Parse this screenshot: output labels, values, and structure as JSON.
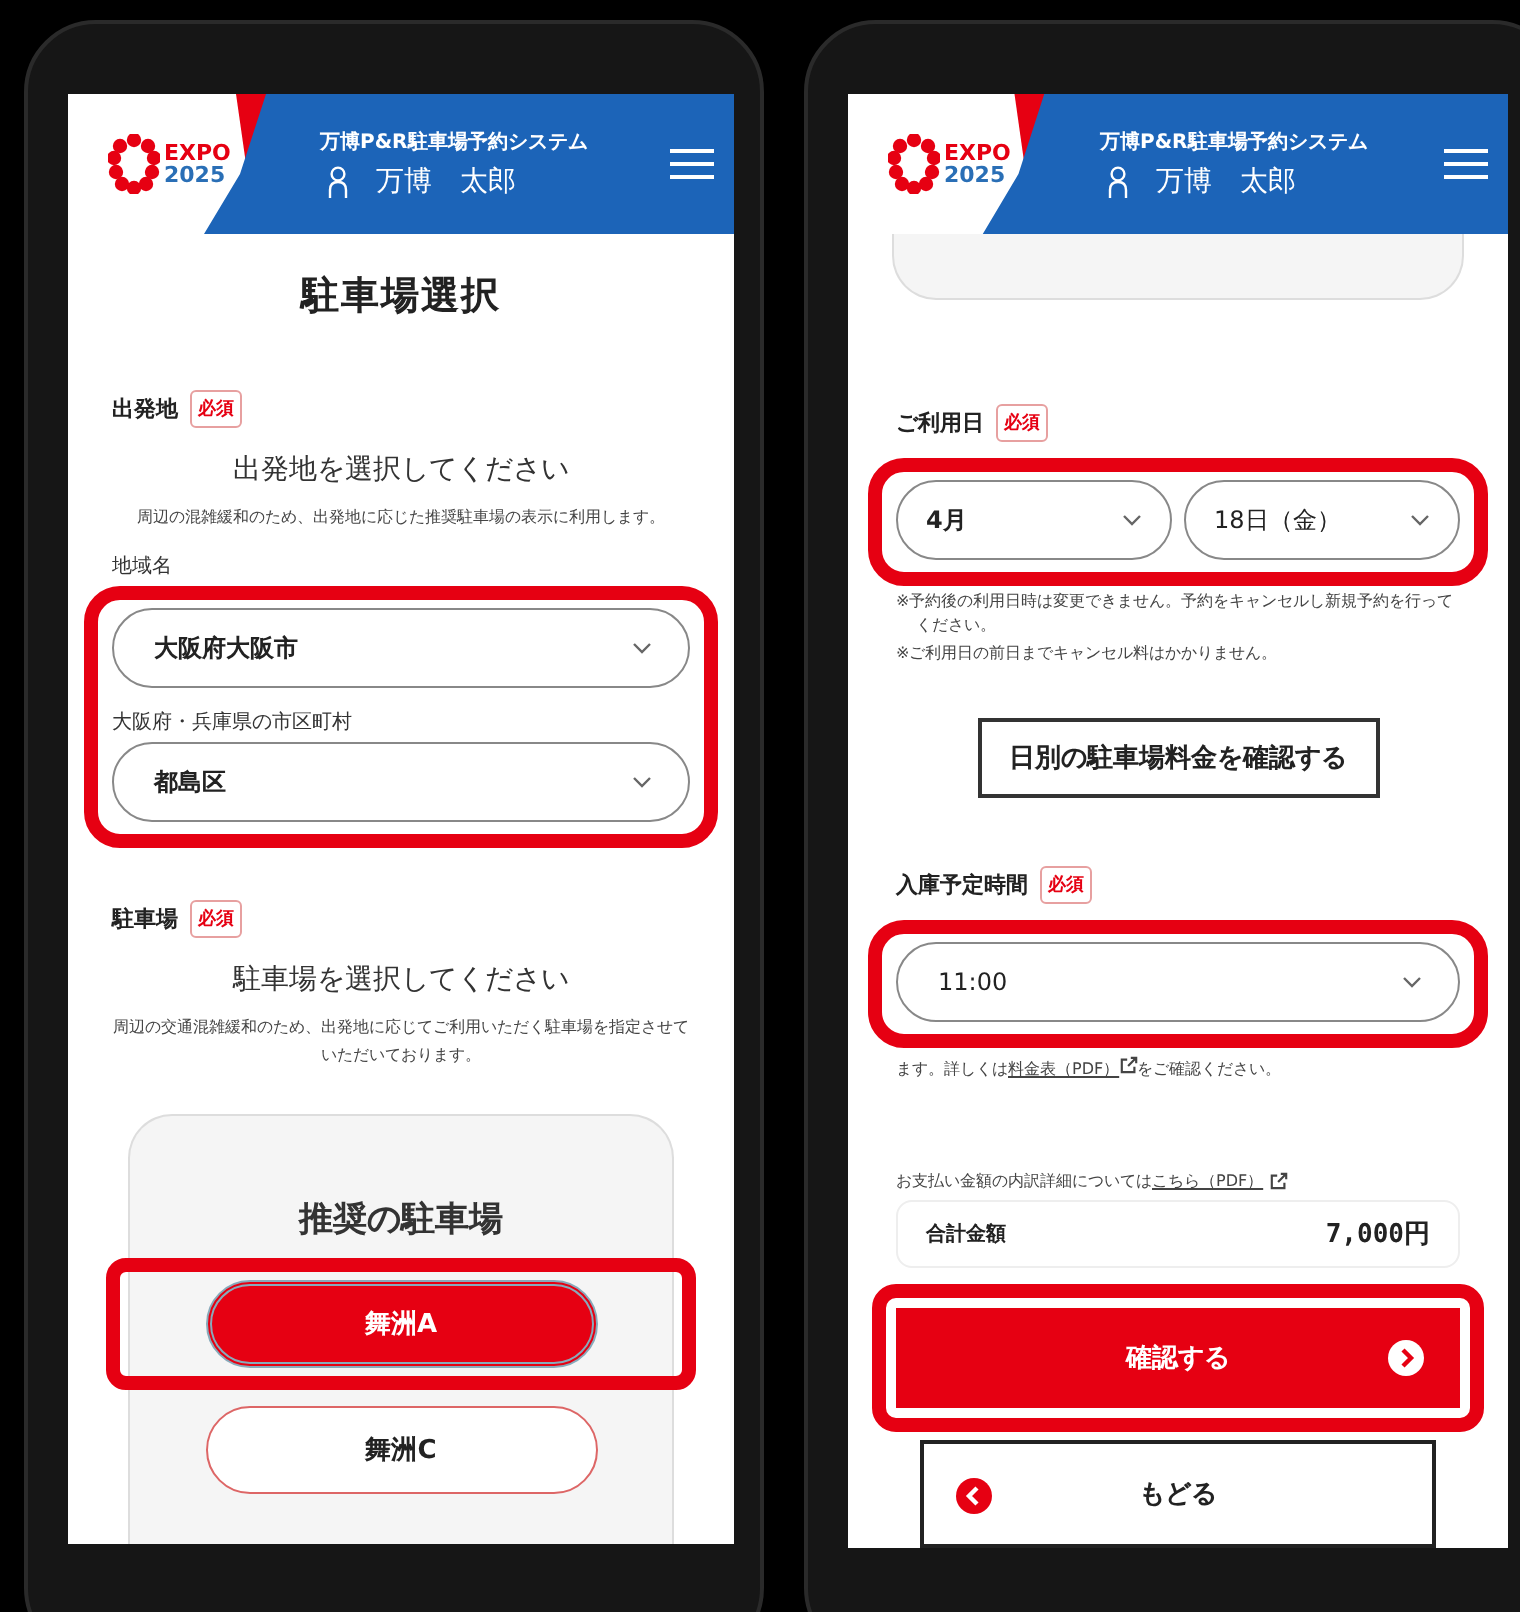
{
  "left_screen": {
    "header": {
      "logo_word": "EXPO",
      "logo_year": "2025",
      "system_title": "万博P&R駐車場予約システム",
      "user_name": "万博　太郎"
    },
    "page_title": "駐車場選択",
    "departure": {
      "label": "出発地",
      "badge": "必須",
      "heading": "出発地を選択してください",
      "note": "周辺の混雑緩和のため、出発地に応じた推奨駐車場の表示に利用します。",
      "highlighted": true,
      "fields": [
        {
          "label": "地域名",
          "value": "大阪府大阪市"
        },
        {
          "label": "大阪府・兵庫県の市区町村",
          "value": "都島区"
        }
      ]
    },
    "parking": {
      "label": "駐車場",
      "badge": "必須",
      "heading": "駐車場を選択してください",
      "note": "周辺の交通混雑緩和のため、出発地に応じてご利用いただく駐車場を指定させていただいております。",
      "card_title": "推奨の駐車場",
      "options": [
        {
          "label": "舞洲A",
          "selected": true,
          "highlighted": true
        },
        {
          "label": "舞洲C",
          "selected": false,
          "highlighted": false
        }
      ]
    }
  },
  "right_screen": {
    "header": {
      "logo_word": "EXPO",
      "logo_year": "2025",
      "system_title": "万博P&R駐車場予約システム",
      "user_name": "万博　太郎"
    },
    "date": {
      "label": "ご利用日",
      "badge": "必須",
      "highlighted": true,
      "selects": [
        "4月",
        "18日（金）"
      ],
      "notes": [
        "※予約後の利用日時は変更できません。予約をキャンセルし新規予約を行ってください。",
        "※ご利用日の前日までキャンセル料はかかりません。"
      ]
    },
    "fee_button": "日別の駐車場料金を確認する",
    "time": {
      "label": "入庫予定時間",
      "badge": "必須",
      "highlighted": true,
      "value": "11:00",
      "note": {
        "before": "ます。詳しくは",
        "link": "料金表（PDF）",
        "after": "をご確認ください。"
      }
    },
    "payment_note": {
      "before": "お支払い金額の内訳詳細については",
      "link": "こちら（PDF）"
    },
    "total": {
      "label": "合計金額",
      "amount": "7,000円"
    },
    "confirm_button": {
      "label": "確認する",
      "highlighted": true
    },
    "back_button": "もどる"
  }
}
